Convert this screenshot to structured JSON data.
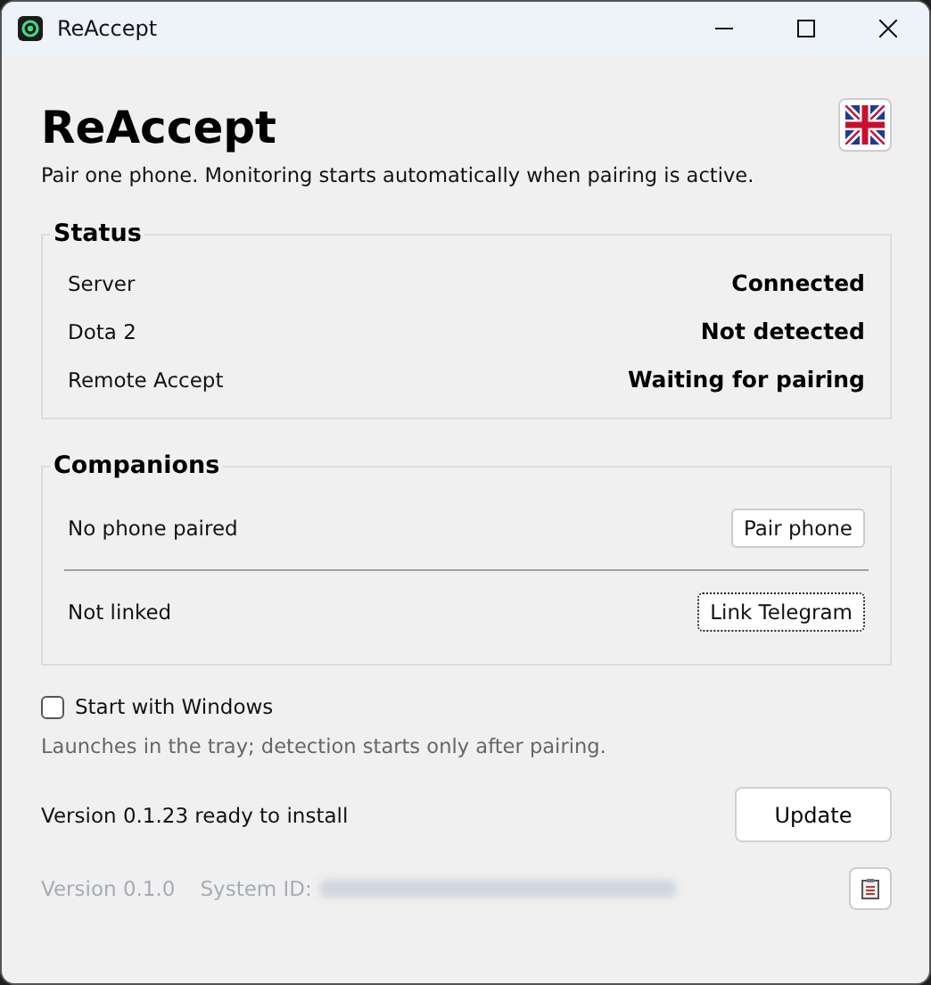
{
  "window": {
    "title": "ReAccept"
  },
  "header": {
    "title": "ReAccept",
    "subtitle": "Pair one phone. Monitoring starts automatically when pairing is active."
  },
  "status": {
    "title": "Status",
    "rows": [
      {
        "label": "Server",
        "value": "Connected"
      },
      {
        "label": "Dota 2",
        "value": "Not detected"
      },
      {
        "label": "Remote Accept",
        "value": "Waiting for pairing"
      }
    ]
  },
  "companions": {
    "title": "Companions",
    "rows": [
      {
        "label": "No phone paired",
        "action": "Pair phone",
        "focused": false
      },
      {
        "label": "Not linked",
        "action": "Link Telegram",
        "focused": true
      }
    ]
  },
  "startup": {
    "label": "Start with Windows",
    "checked": false,
    "hint": "Launches in the tray; detection starts only after pairing."
  },
  "update": {
    "message": "Version 0.1.23 ready to install",
    "button": "Update"
  },
  "footer": {
    "version": "Version 0.1.0",
    "system_id_label": "System ID:"
  }
}
